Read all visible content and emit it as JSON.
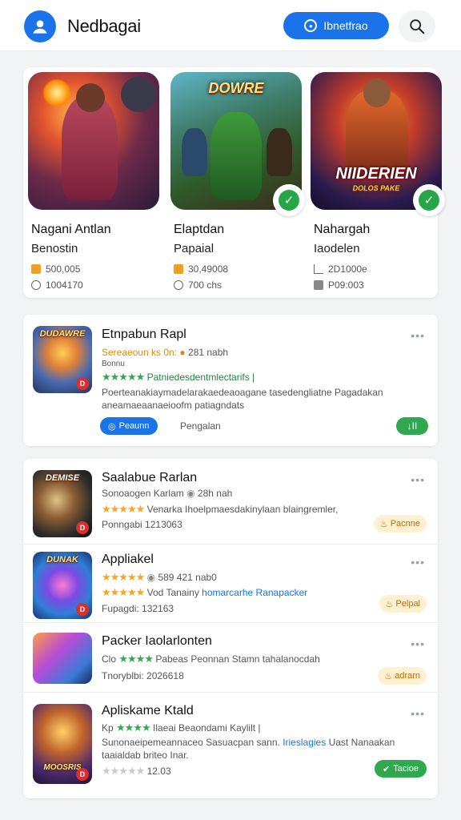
{
  "header": {
    "title": "Nedbagai",
    "action_label": "Ibnetfrao"
  },
  "featured": [
    {
      "name": "Nagani Antlan",
      "subtitle": "Benostin",
      "stat1": "500,005",
      "stat2": "1004170",
      "verified": false,
      "art_text": ""
    },
    {
      "name": "Elaptdan",
      "subtitle": "Papaial",
      "stat1": "30,49008",
      "stat2": "700 chs",
      "verified": true,
      "art_text": "DOWRE"
    },
    {
      "name": "Nahargah",
      "subtitle": "Iaodelen",
      "stat1": "2D1000e",
      "stat2": "P09:003",
      "verified": true,
      "art_text": "NIIDERIEN"
    }
  ],
  "featured_art_subtext": "DOLOS PAKE",
  "app_list_top": {
    "title": "Etnpabun Rapl",
    "line1_a": "Sereaeoun ks 0n:",
    "line1_b": "281 nabh",
    "line2": "Bonnu",
    "stars": "★★★★★",
    "line3": "Patniedesdentmlectarifs |",
    "desc": "Poerteanakiaymadelarakaedeaoagane tasedengliatne Pagadakan",
    "desc2": "aneamaeaanaeioofm patiagndats",
    "pill_label": "Peaunn",
    "pill_text": "Pengalan",
    "action_label": "II",
    "thumb_text": "DUDAWRE",
    "thumb_badge": "D"
  },
  "app_list": [
    {
      "title": "Saalabue Rarlan",
      "line1": "Sonoaogen Karlam",
      "line1_b": "28h nah",
      "stars": "★★★★★",
      "line2": "Venarka Ihoelpmaesdakinylaan blaingremler,",
      "meta": "Ponngabi 1213063",
      "pill": "Pacnne",
      "pill_style": "orange",
      "thumb_text": "DEMISE",
      "thumb_badge": "D"
    },
    {
      "title": "Appliakel",
      "line1_b": "589 421 nab0",
      "stars": "★★★★★",
      "stars2": "★★★★★",
      "line2a": "Vod",
      "line2b": "Tanainy",
      "line2c": "homarcarhe Ranapacker",
      "meta": "Fupagdi: 132163",
      "pill": "Pelpal",
      "pill_style": "orange",
      "thumb_text": "DUNAK",
      "thumb_badge": "D"
    },
    {
      "title": "Packer Iaolarlonten",
      "line1a": "Clo",
      "stars": "★★★★",
      "line1b": "Pabeas Peonnan Stamn tahalanocdah",
      "meta": "Tnoryblbi: 2026618",
      "pill": "adrarn",
      "pill_style": "orange",
      "thumb_text": "",
      "thumb_badge": ""
    },
    {
      "title": "Apliskame Ktald",
      "line1a": "Kp",
      "stars": "★★★★",
      "line1b": "Ilaeai Beaondami Kaylilt |",
      "line2a": "Sunonaeipemeannaceo Sasuacpan sann.",
      "line2b": "Irieslagies",
      "line2c": "Uast Nanaakan",
      "line3": "taaialdab briteo Inar.",
      "stars_gray": "★★★★★",
      "meta": "12.03",
      "pill": "Tacioe",
      "pill_style": "green",
      "thumb_text": "MOOSRIS",
      "thumb_badge": "D"
    }
  ],
  "colors": {
    "accent": "#1a73e8",
    "success": "#2fa84f",
    "warn_bg": "#fff0cf",
    "star": "#f5a623"
  },
  "icons": {
    "header_avatar": "user-icon",
    "header_search": "search-icon",
    "verified": "check-icon",
    "more": "more-horizontal-icon"
  }
}
